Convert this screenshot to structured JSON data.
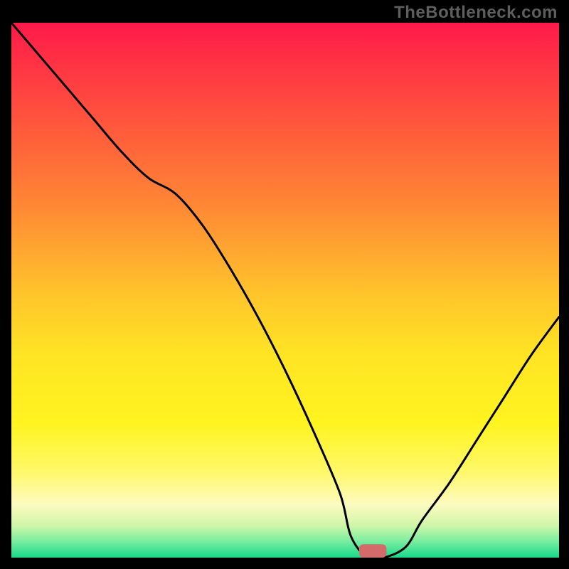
{
  "watermark_text": "TheBottleneck.com",
  "chart_data": {
    "type": "line",
    "title": "",
    "xlabel": "",
    "ylabel": "",
    "xlim": [
      0,
      100
    ],
    "ylim": [
      0,
      100
    ],
    "x": [
      0,
      5,
      10,
      15,
      20,
      25,
      30,
      35,
      40,
      45,
      50,
      55,
      60,
      62,
      65,
      68,
      72,
      75,
      80,
      85,
      90,
      95,
      100
    ],
    "values": [
      100,
      94,
      88,
      82,
      76,
      71,
      68,
      62,
      54,
      45,
      35,
      24,
      12,
      4,
      0,
      0,
      2,
      7,
      14,
      22,
      30,
      38,
      45
    ],
    "marker": {
      "x_center": 66,
      "y": 0,
      "width": 5,
      "height": 2.5,
      "color": "#d46a6a"
    },
    "gradient_stops": [
      {
        "offset": 0,
        "color": "#ff1a4a"
      },
      {
        "offset": 0.05,
        "color": "#ff2a46"
      },
      {
        "offset": 0.2,
        "color": "#ff5a3c"
      },
      {
        "offset": 0.35,
        "color": "#ff8a34"
      },
      {
        "offset": 0.5,
        "color": "#ffc22c"
      },
      {
        "offset": 0.62,
        "color": "#ffe424"
      },
      {
        "offset": 0.75,
        "color": "#fff420"
      },
      {
        "offset": 0.84,
        "color": "#fff86a"
      },
      {
        "offset": 0.9,
        "color": "#fdfbc0"
      },
      {
        "offset": 0.94,
        "color": "#d0f6a8"
      },
      {
        "offset": 0.97,
        "color": "#78eda0"
      },
      {
        "offset": 1.0,
        "color": "#18d98a"
      }
    ]
  }
}
